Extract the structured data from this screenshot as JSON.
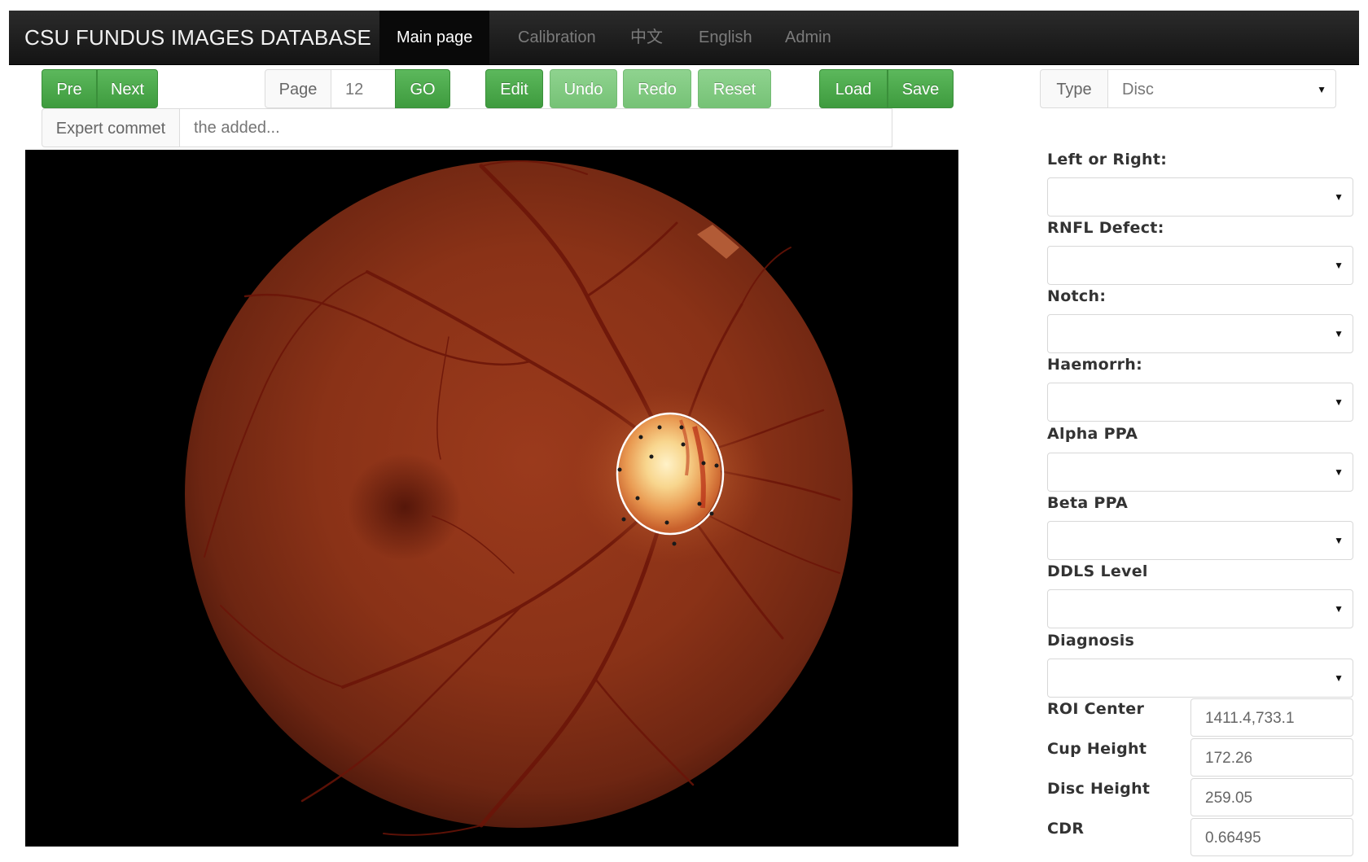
{
  "navbar": {
    "brand": "CSU FUNDUS IMAGES DATABASE",
    "items": [
      {
        "label": "Main page"
      },
      {
        "label": "Calibration"
      },
      {
        "label": "中文"
      },
      {
        "label": "English"
      },
      {
        "label": "Admin"
      }
    ]
  },
  "toolbar": {
    "pre_label": "Pre",
    "next_label": "Next",
    "page_label": "Page",
    "page_value": "12",
    "go_label": "GO",
    "edit_label": "Edit",
    "undo_label": "Undo",
    "redo_label": "Redo",
    "reset_label": "Reset",
    "load_label": "Load",
    "save_label": "Save",
    "type_label": "Type",
    "type_value": "Disc"
  },
  "comment": {
    "label": "Expert commet",
    "placeholder": "the added..."
  },
  "panel": {
    "left_or_right_label": "Left or Right:",
    "rnfl_defect_label": "RNFL Defect:",
    "notch_label": "Notch:",
    "haemorrh_label": "Haemorrh:",
    "alpha_ppa_label": "Alpha PPA",
    "beta_ppa_label": "Beta PPA",
    "ddls_level_label": "DDLS Level",
    "diagnosis_label": "Diagnosis",
    "roi_center_label": "ROI Center",
    "roi_center_value": "1411.4,733.1",
    "cup_height_label": "Cup Height",
    "cup_height_value": "172.26",
    "disc_height_label": "Disc Height",
    "disc_height_value": "259.05",
    "cdr_label": "CDR",
    "cdr_value": "0.66495"
  },
  "colors": {
    "navbar_bg": "#1a1a1a",
    "button_green": "#4cae4c",
    "button_green_light": "#80c980"
  }
}
